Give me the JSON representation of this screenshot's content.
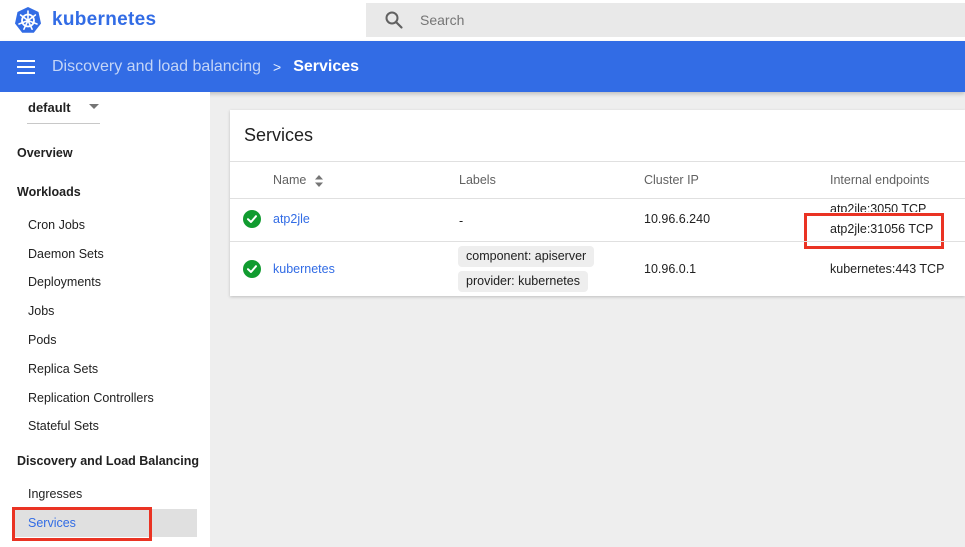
{
  "brand": {
    "name": "kubernetes"
  },
  "search": {
    "placeholder": "Search"
  },
  "breadcrumb": {
    "parent": "Discovery and load balancing",
    "separator": ">",
    "current": "Services"
  },
  "namespace": {
    "selected": "default"
  },
  "sidebar": {
    "overview": "Overview",
    "workloads": {
      "title": "Workloads",
      "items": [
        "Cron Jobs",
        "Daemon Sets",
        "Deployments",
        "Jobs",
        "Pods",
        "Replica Sets",
        "Replication Controllers",
        "Stateful Sets"
      ]
    },
    "discovery": {
      "title": "Discovery and Load Balancing",
      "items": [
        "Ingresses",
        "Services"
      ]
    }
  },
  "services_card": {
    "title": "Services",
    "columns": [
      "Name",
      "Labels",
      "Cluster IP",
      "Internal endpoints"
    ],
    "rows": [
      {
        "status": "ok",
        "name": "atp2jle",
        "labels": [
          "-"
        ],
        "cluster_ip": "10.96.6.240",
        "endpoints": [
          "atp2jle:3050 TCP",
          "atp2jle:31056 TCP"
        ]
      },
      {
        "status": "ok",
        "name": "kubernetes",
        "labels": [
          "component: apiserver",
          "provider: kubernetes"
        ],
        "cluster_ip": "10.96.0.1",
        "endpoints": [
          "kubernetes:443 TCP"
        ]
      }
    ]
  },
  "colors": {
    "brand": "#326ce5",
    "status_ok": "#109b2f",
    "highlight": "#ea3323"
  }
}
